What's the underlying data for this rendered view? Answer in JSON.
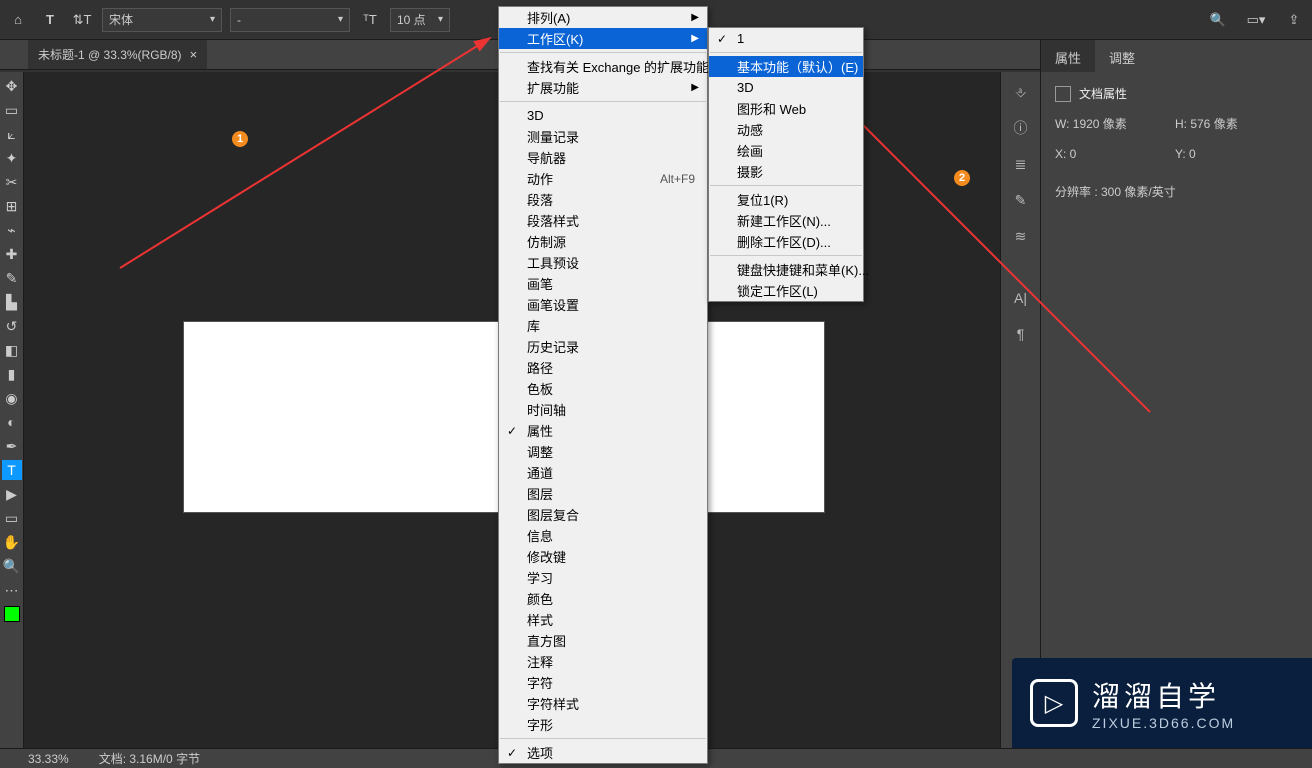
{
  "optionsBar": {
    "fontFamily": "宋体",
    "fontStyle": "-",
    "fontSizeLabel": "10 点"
  },
  "tab": {
    "title": "未标题-1 @ 33.3%(RGB/8)"
  },
  "menuWindow": {
    "arrange": "排列(A)",
    "workspace": "工作区(K)",
    "findExtensions": "查找有关 Exchange 的扩展功能...",
    "extensions": "扩展功能",
    "_3d": "3D",
    "measureLog": "测量记录",
    "navigator": "导航器",
    "actions": "动作",
    "actionsShortcut": "Alt+F9",
    "paragraph": "段落",
    "paragraphStyles": "段落样式",
    "cloneSource": "仿制源",
    "toolPresets": "工具预设",
    "brush": "画笔",
    "brushSettings": "画笔设置",
    "library": "库",
    "history": "历史记录",
    "paths": "路径",
    "swatches": "色板",
    "timeline": "时间轴",
    "properties": "属性",
    "adjustments": "调整",
    "channels": "通道",
    "layers": "图层",
    "layerComps": "图层复合",
    "info": "信息",
    "modifierKeys": "修改键",
    "learn": "学习",
    "color": "颜色",
    "styles": "样式",
    "histogram": "直方图",
    "notes": "注释",
    "character": "字符",
    "characterStyles": "字符样式",
    "glyphs": "字形",
    "options": "选项"
  },
  "menuWorkspace": {
    "one": "1",
    "essentialsDefault": "基本功能（默认）(E)",
    "_3d": "3D",
    "graphicsWeb": "图形和 Web",
    "motion": "动感",
    "painting": "绘画",
    "photography": "摄影",
    "reset": "复位1(R)",
    "newWorkspace": "新建工作区(N)...",
    "deleteWorkspace": "删除工作区(D)...",
    "keyboardMenus": "键盘快捷键和菜单(K)...",
    "lockWorkspace": "锁定工作区(L)"
  },
  "propertiesPanel": {
    "tabProperties": "属性",
    "tabAdjust": "调整",
    "docProperties": "文档属性",
    "w": "W:  1920 像素",
    "h": "H:  576 像素",
    "x": "X:  0",
    "y": "Y:  0",
    "resolution": "分辨率 :  300 像素/英寸"
  },
  "status": {
    "zoom": "33.33%",
    "doc": "文档: 3.16M/0 字节"
  },
  "watermark": {
    "large": "溜溜自学",
    "small": "ZIXUE.3D66.COM"
  },
  "annotations": {
    "b1": "1",
    "b2": "2"
  }
}
